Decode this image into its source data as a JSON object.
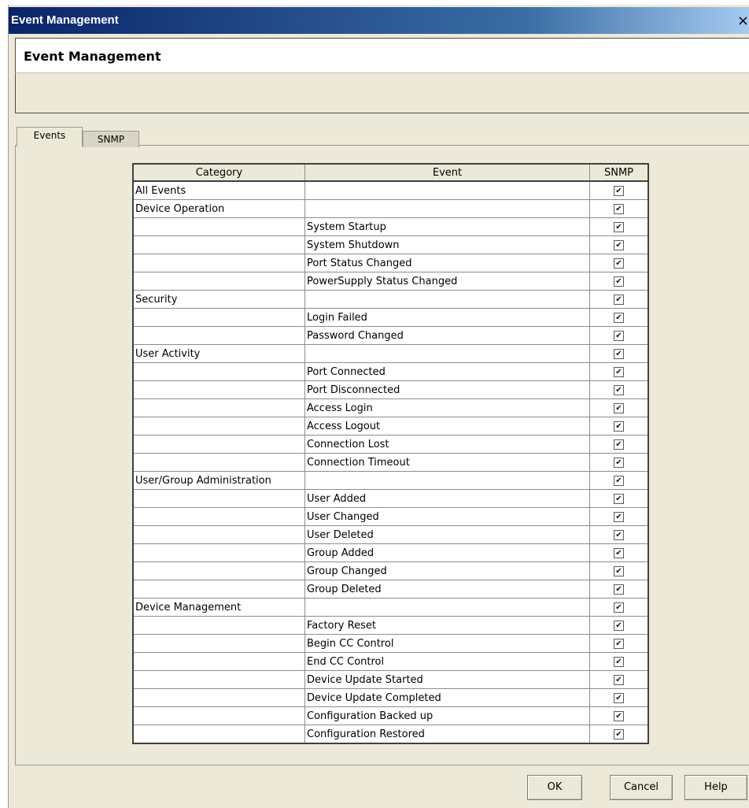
{
  "window": {
    "title": "Event Management",
    "close_glyph": "×"
  },
  "header": {
    "title": "Event Management"
  },
  "tabs": [
    {
      "label": "Events",
      "selected": true
    },
    {
      "label": "SNMP",
      "selected": false
    }
  ],
  "table": {
    "columns": [
      "Category",
      "Event",
      "SNMP"
    ],
    "rows": [
      {
        "category": "All Events",
        "event": "",
        "snmp": true
      },
      {
        "category": "Device Operation",
        "event": "",
        "snmp": true
      },
      {
        "category": "",
        "event": "System Startup",
        "snmp": true
      },
      {
        "category": "",
        "event": "System Shutdown",
        "snmp": true
      },
      {
        "category": "",
        "event": "Port Status Changed",
        "snmp": true
      },
      {
        "category": "",
        "event": "PowerSupply Status Changed",
        "snmp": true
      },
      {
        "category": "Security",
        "event": "",
        "snmp": true
      },
      {
        "category": "",
        "event": "Login Failed",
        "snmp": true
      },
      {
        "category": "",
        "event": "Password Changed",
        "snmp": true
      },
      {
        "category": "User Activity",
        "event": "",
        "snmp": true
      },
      {
        "category": "",
        "event": "Port Connected",
        "snmp": true
      },
      {
        "category": "",
        "event": "Port Disconnected",
        "snmp": true
      },
      {
        "category": "",
        "event": "Access Login",
        "snmp": true
      },
      {
        "category": "",
        "event": "Access Logout",
        "snmp": true
      },
      {
        "category": "",
        "event": "Connection Lost",
        "snmp": true
      },
      {
        "category": "",
        "event": "Connection Timeout",
        "snmp": true
      },
      {
        "category": "User/Group Administration",
        "event": "",
        "snmp": true
      },
      {
        "category": "",
        "event": "User Added",
        "snmp": true
      },
      {
        "category": "",
        "event": "User Changed",
        "snmp": true
      },
      {
        "category": "",
        "event": "User Deleted",
        "snmp": true
      },
      {
        "category": "",
        "event": "Group Added",
        "snmp": true
      },
      {
        "category": "",
        "event": "Group Changed",
        "snmp": true
      },
      {
        "category": "",
        "event": "Group Deleted",
        "snmp": true
      },
      {
        "category": "Device Management",
        "event": "",
        "snmp": true
      },
      {
        "category": "",
        "event": "Factory Reset",
        "snmp": true
      },
      {
        "category": "",
        "event": "Begin CC Control",
        "snmp": true
      },
      {
        "category": "",
        "event": "End CC Control",
        "snmp": true
      },
      {
        "category": "",
        "event": "Device Update Started",
        "snmp": true
      },
      {
        "category": "",
        "event": "Device Update Completed",
        "snmp": true
      },
      {
        "category": "",
        "event": "Configuration Backed up",
        "snmp": true
      },
      {
        "category": "",
        "event": "Configuration Restored",
        "snmp": true
      }
    ]
  },
  "buttons": {
    "ok": "OK",
    "cancel": "Cancel",
    "help": "Help"
  },
  "colors": {
    "titlebar_start": "#0a246a",
    "dialog_bg": "#ece9d8"
  }
}
